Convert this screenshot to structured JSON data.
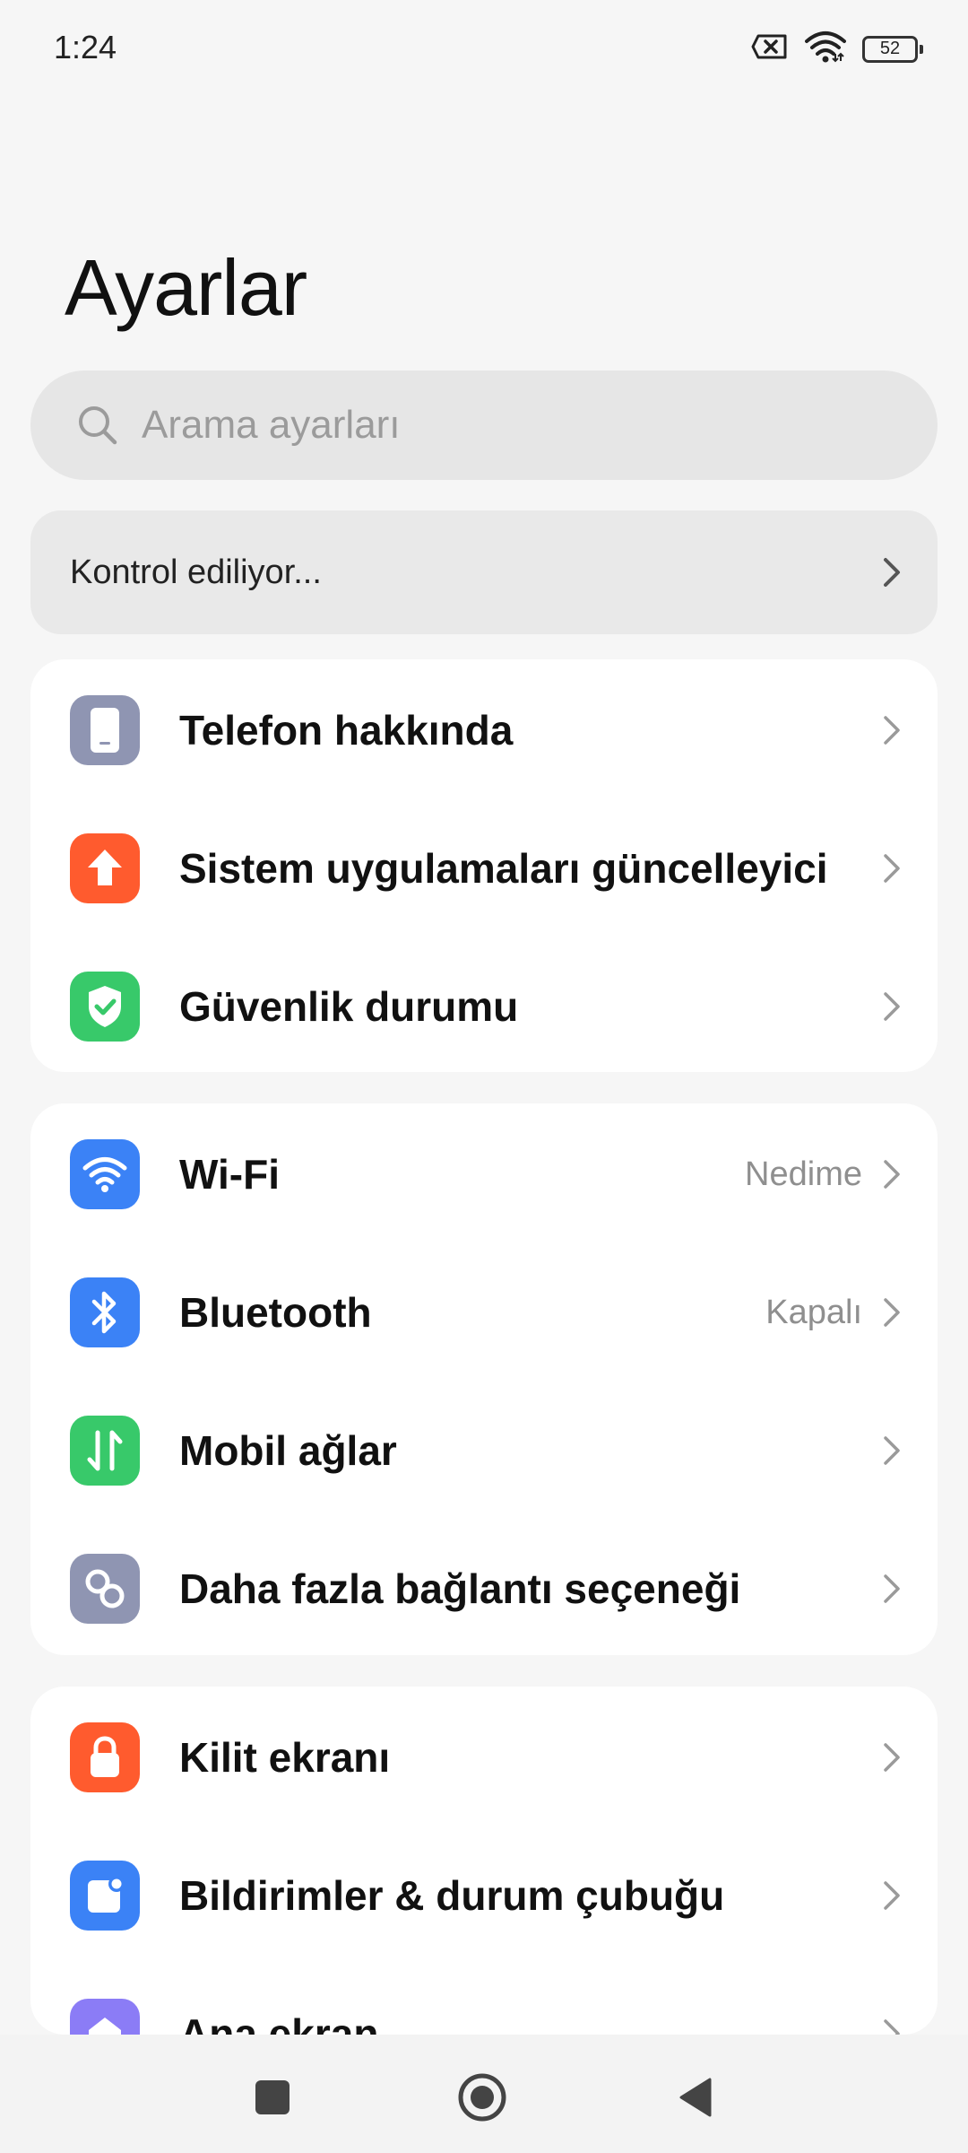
{
  "status_bar": {
    "time": "1:24",
    "battery": "52"
  },
  "title": "Ayarlar",
  "search": {
    "placeholder": "Arama ayarları"
  },
  "update_check": {
    "label": "Kontrol ediliyor..."
  },
  "groups": [
    {
      "items": [
        {
          "label": "Telefon hakkında",
          "icon": "phone-icon",
          "color": "#8f95b2"
        },
        {
          "label": "Sistem uygulamaları güncelleyici",
          "icon": "arrow-up-icon",
          "color": "#ff5b2e"
        },
        {
          "label": "Güvenlik durumu",
          "icon": "shield-check-icon",
          "color": "#38c96a"
        }
      ]
    },
    {
      "items": [
        {
          "label": "Wi-Fi",
          "value": "Nedime",
          "icon": "wifi-icon",
          "color": "#3b82f6"
        },
        {
          "label": "Bluetooth",
          "value": "Kapalı",
          "icon": "bluetooth-icon",
          "color": "#3b82f6"
        },
        {
          "label": "Mobil ağlar",
          "icon": "mobile-data-icon",
          "color": "#38c96a"
        },
        {
          "label": "Daha fazla bağlantı seçeneği",
          "icon": "link-icon",
          "color": "#8f95b2"
        }
      ]
    },
    {
      "items": [
        {
          "label": "Kilit ekranı",
          "icon": "lock-icon",
          "color": "#ff5b2e"
        },
        {
          "label": "Bildirimler & durum çubuğu",
          "icon": "notification-icon",
          "color": "#3b82f6"
        },
        {
          "label": "Ana ekran",
          "icon": "home-icon",
          "color": "#8b7cf6"
        }
      ]
    }
  ],
  "nav_bar": {
    "recents_icon": "square-icon",
    "home_icon": "circle-icon",
    "back_icon": "triangle-back-icon"
  }
}
